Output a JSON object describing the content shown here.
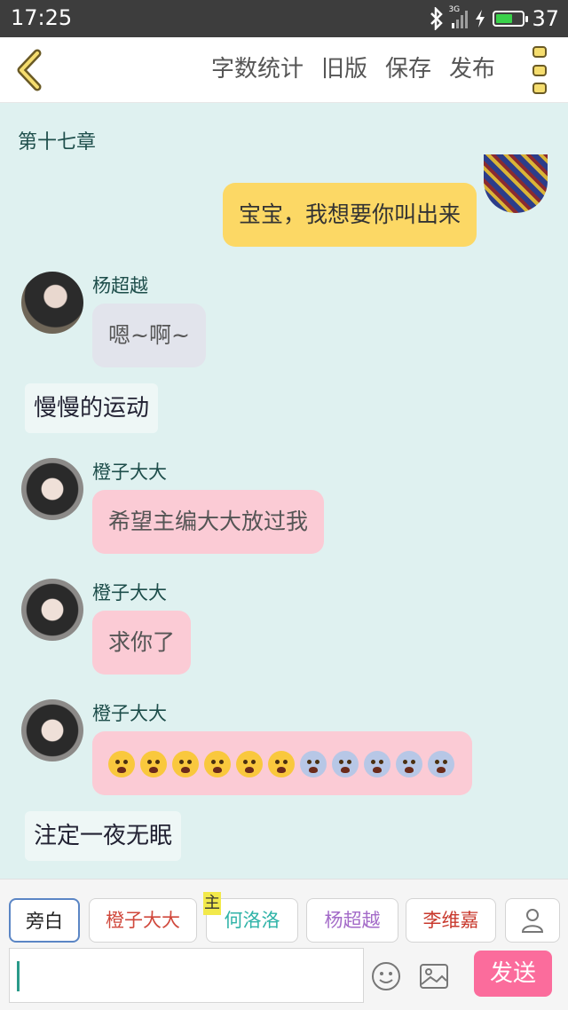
{
  "status_bar": {
    "time": "17:25",
    "network": "3G",
    "battery_level": "37"
  },
  "toolbar": {
    "word_count": "字数统计",
    "old_version": "旧版",
    "save": "保存",
    "publish": "发布"
  },
  "chat": {
    "chapter_title": "第十七章",
    "messages": [
      {
        "type": "right",
        "text": "宝宝，我想要你叫出来"
      },
      {
        "type": "left",
        "name": "杨超越",
        "text": "嗯~啊~"
      },
      {
        "type": "narration",
        "text": "慢慢的运动"
      },
      {
        "type": "left",
        "name": "橙子大大",
        "text": "希望主编大大放过我"
      },
      {
        "type": "left",
        "name": "橙子大大",
        "text": "求你了"
      },
      {
        "type": "left",
        "name": "橙子大大",
        "emojis": [
          "cry",
          "cry",
          "cry",
          "cry",
          "cry",
          "cry",
          "scream",
          "scream",
          "scream",
          "scream",
          "scream"
        ]
      },
      {
        "type": "narration",
        "text": "注定一夜无眠"
      }
    ]
  },
  "bottom": {
    "roles": [
      {
        "label": "旁白",
        "color": "#555555"
      },
      {
        "label": "橙子大大",
        "color": "#d0483c"
      },
      {
        "label": "何洛洛",
        "color": "#2fb3a8",
        "tag": "主"
      },
      {
        "label": "杨超越",
        "color": "#a36ac8"
      },
      {
        "label": "李维嘉",
        "color": "#c8382c"
      }
    ],
    "send_label": "发送"
  },
  "colors": {
    "accent": "#fb6c9c",
    "background": "#dff1f0",
    "yellow_bubble": "#fcd865",
    "pink_bubble": "#fbcbd5"
  }
}
